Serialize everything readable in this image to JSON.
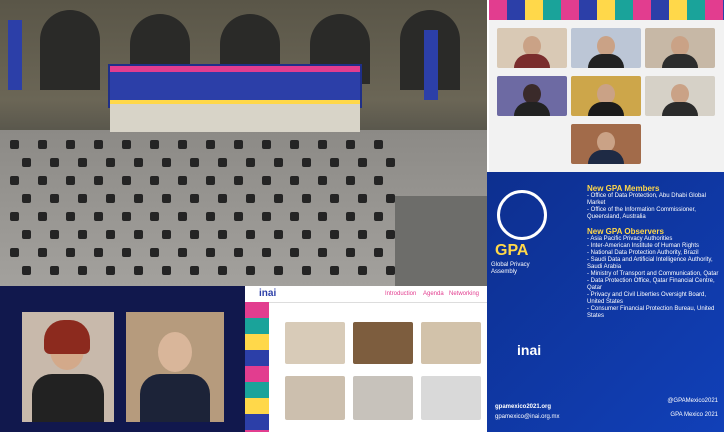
{
  "gpa_slide": {
    "members_title": "New GPA Members",
    "members": [
      "- Office of Data Protection, Abu Dhabi Global Market",
      "- Office of the Information Commissioner, Queensland, Australia"
    ],
    "observers_title": "New GPA Observers",
    "observers": [
      "- Asia Pacific Privacy Authorities",
      "- Inter-American Institute of Human Rights",
      "- National Data Protection Authority, Brazil",
      "- Saudi Data and Artificial Intelligence Authority, Saudi Arabia",
      "- Ministry of Transport and Communication, Qatar",
      "- Data Protection Office, Qatar Financial Centre, Qatar",
      "- Privacy and Civil Liberties Oversight Board, United States",
      "- Consumer Financial Protection Bureau, United States"
    ],
    "logo_text": "GPA",
    "logo_sub": "Global Privacy Assembly",
    "brand": "inai",
    "site": "gpamexico2021.org",
    "email": "gpamexico@inai.org.mx",
    "handle1": "@GPAMexico2021",
    "handle2": "GPA Mexico 2021"
  },
  "zoom_bottom_middle": {
    "brand": "inai",
    "nav": [
      "Introduction",
      "Agenda",
      "Networking"
    ]
  },
  "colors": {
    "gpa_blue": "#1140b8",
    "stage_blue": "#2c3fa8",
    "accent_yellow": "#ffd84a",
    "accent_pink": "#e23d8f"
  }
}
